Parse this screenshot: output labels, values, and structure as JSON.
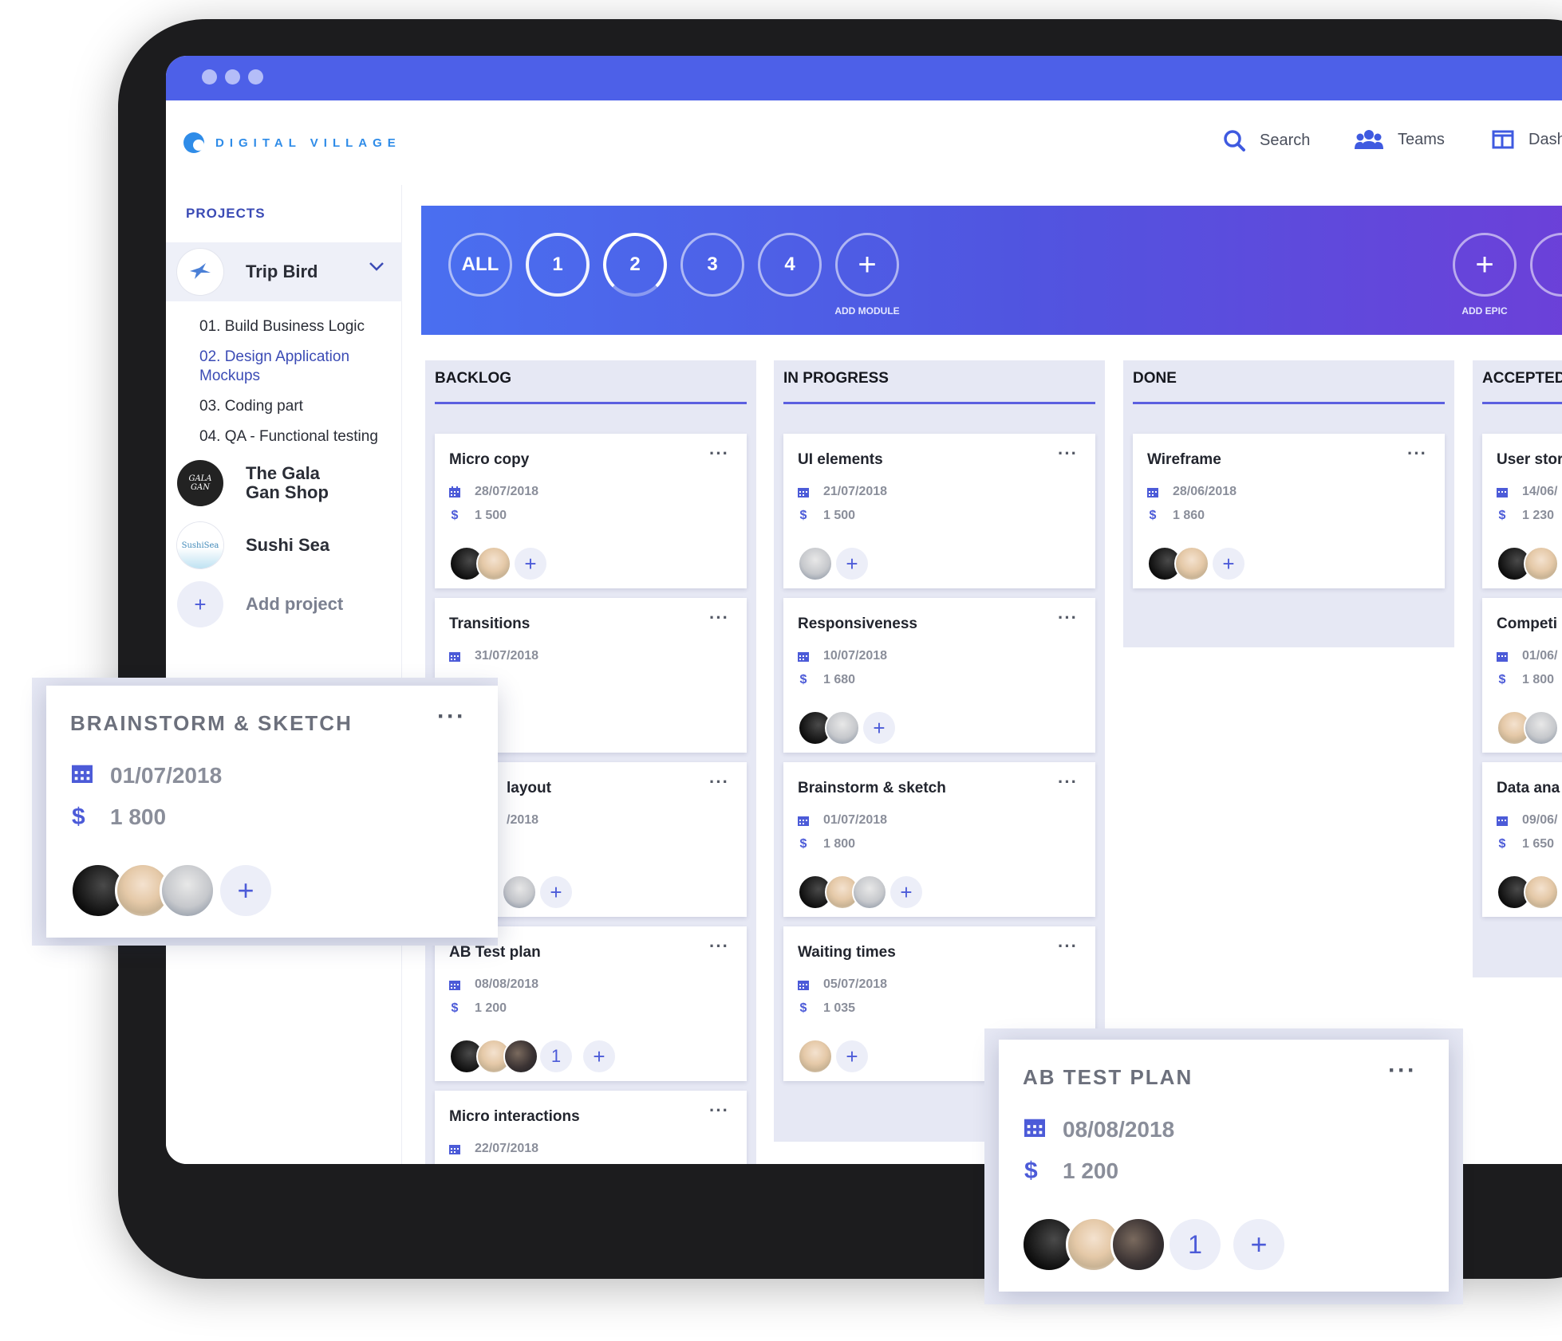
{
  "app": {
    "logo_text": "DIGITAL VILLAGE"
  },
  "nav": {
    "search": "Search",
    "teams": "Teams",
    "dash": "Dash"
  },
  "sidebar": {
    "title": "PROJECTS",
    "projects": [
      {
        "name": "Trip Bird",
        "active": true
      },
      {
        "name_line1": "The Gala",
        "name_line2": "Gan Shop"
      },
      {
        "name": "Sushi Sea"
      }
    ],
    "subitems": [
      "01. Build Business Logic",
      "02. Design Application",
      "Mockups",
      "03. Coding part",
      "04. QA - Functional testing"
    ],
    "add_project": "Add project",
    "gala_logo_text": "GALA GAN",
    "sushi_logo_text": "SushiSea"
  },
  "banner": {
    "modules": [
      "ALL",
      "1",
      "2",
      "3",
      "4"
    ],
    "add_module": "ADD MODULE",
    "add_epic": "ADD EPIC"
  },
  "board": {
    "columns": [
      {
        "title": "BACKLOG",
        "cards": [
          {
            "title": "Micro copy",
            "date": "28/07/2018",
            "amount": "1 500"
          },
          {
            "title": "Transitions",
            "date": "31/07/2018"
          },
          {
            "title": "layout",
            "date": "/2018"
          },
          {
            "title": "AB Test plan",
            "date": "08/08/2018",
            "amount": "1 200",
            "extra": "1"
          },
          {
            "title": "Micro interactions",
            "date": "22/07/2018"
          }
        ]
      },
      {
        "title": "IN PROGRESS",
        "cards": [
          {
            "title": "UI elements",
            "date": "21/07/2018",
            "amount": "1 500"
          },
          {
            "title": "Responsiveness",
            "date": "10/07/2018",
            "amount": "1 680"
          },
          {
            "title": "Brainstorm & sketch",
            "date": "01/07/2018",
            "amount": "1 800"
          },
          {
            "title": "Waiting times",
            "date": "05/07/2018",
            "amount": "1 035"
          }
        ]
      },
      {
        "title": "DONE",
        "cards": [
          {
            "title": "Wireframe",
            "date": "28/06/2018",
            "amount": "1 860"
          }
        ]
      },
      {
        "title": "ACCEPTED",
        "cards": [
          {
            "title": "User stor",
            "date": "14/06/",
            "amount": "1 230"
          },
          {
            "title": "Competi",
            "date": "01/06/",
            "amount": "1 800"
          },
          {
            "title": "Data ana",
            "date": "09/06/",
            "amount": "1 650"
          }
        ]
      }
    ]
  },
  "popups": {
    "brainstorm": {
      "title": "BRAINSTORM & SKETCH",
      "date": "01/07/2018",
      "amount": "1 800"
    },
    "abtest": {
      "title": "AB TEST PLAN",
      "date": "08/08/2018",
      "amount": "1 200",
      "extra": "1"
    }
  },
  "symbols": {
    "more": "···",
    "dollar": "$",
    "plus": "+"
  },
  "colors": {
    "primary": "#4d60e8",
    "accent": "#3b4bb5",
    "logo": "#2f8ce8",
    "column_bg": "#e6e8f4"
  }
}
